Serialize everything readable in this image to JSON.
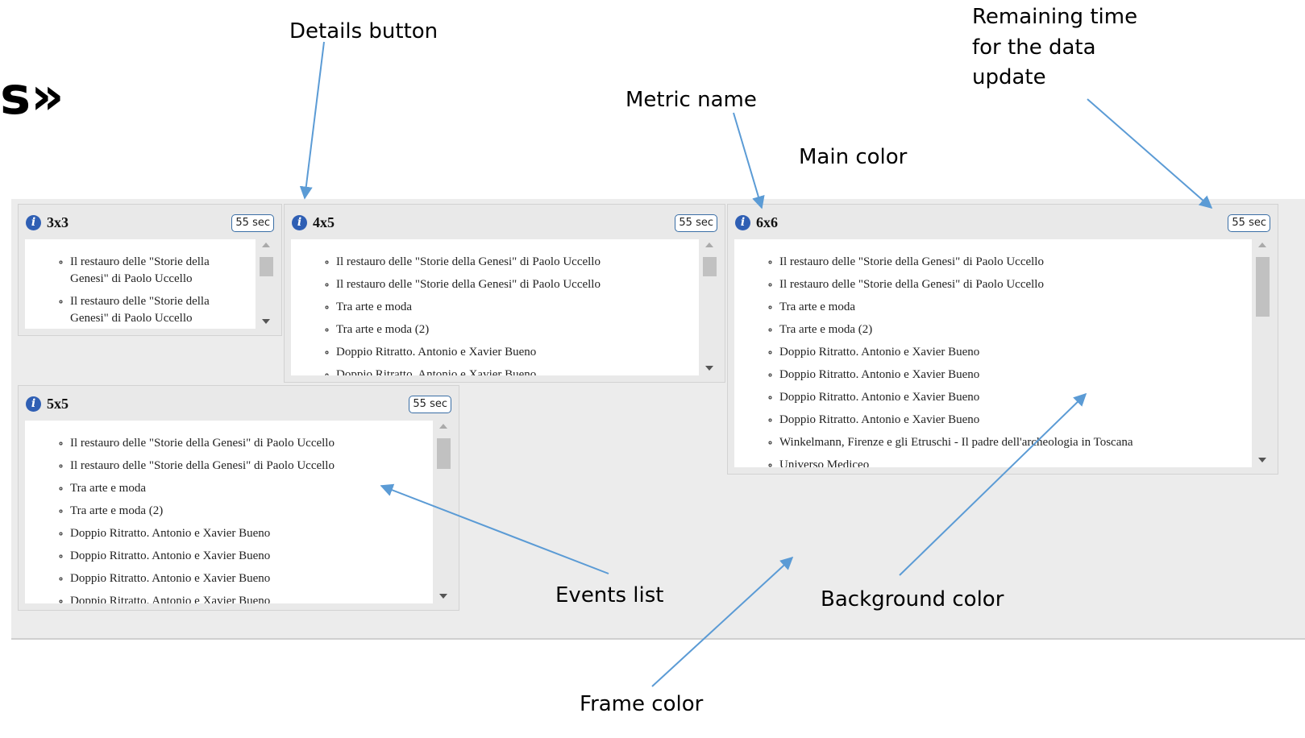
{
  "heading_fragment": "s»",
  "annotations": {
    "details_button": "Details button",
    "remaining_time": [
      "Remaining time",
      "for the data",
      "update"
    ],
    "metric_name": "Metric name",
    "main_color": "Main color",
    "events_list": "Events list",
    "background_color": "Background color",
    "frame_color": "Frame color"
  },
  "widgets": [
    {
      "metric": "3x3",
      "remaining": "55 sec",
      "events": [
        "Il restauro delle \"Storie della Genesi\" di Paolo Uccello",
        "Il restauro delle \"Storie della Genesi\" di Paolo Uccello"
      ]
    },
    {
      "metric": "4x5",
      "remaining": "55 sec",
      "events": [
        "Il restauro delle \"Storie della Genesi\" di Paolo Uccello",
        "Il restauro delle \"Storie della Genesi\" di Paolo Uccello",
        "Tra arte e moda",
        "Tra arte e moda (2)",
        "Doppio Ritratto. Antonio e Xavier Bueno",
        "Doppio Ritratto. Antonio e Xavier Bueno"
      ]
    },
    {
      "metric": "6x6",
      "remaining": "55 sec",
      "events": [
        "Il restauro delle \"Storie della Genesi\" di Paolo Uccello",
        "Il restauro delle \"Storie della Genesi\" di Paolo Uccello",
        "Tra arte e moda",
        "Tra arte e moda (2)",
        "Doppio Ritratto. Antonio e Xavier Bueno",
        "Doppio Ritratto. Antonio e Xavier Bueno",
        "Doppio Ritratto. Antonio e Xavier Bueno",
        "Doppio Ritratto. Antonio e Xavier Bueno",
        "Winkelmann, Firenze e gli Etruschi - Il padre dell'archeologia in Toscana",
        "Universo Mediceo"
      ]
    },
    {
      "metric": "5x5",
      "remaining": "55 sec",
      "events": [
        "Il restauro delle \"Storie della Genesi\" di Paolo Uccello",
        "Il restauro delle \"Storie della Genesi\" di Paolo Uccello",
        "Tra arte e moda",
        "Tra arte e moda (2)",
        "Doppio Ritratto. Antonio e Xavier Bueno",
        "Doppio Ritratto. Antonio e Xavier Bueno",
        "Doppio Ritratto. Antonio e Xavier Bueno",
        "Doppio Ritratto. Antonio e Xavier Bueno"
      ]
    }
  ],
  "colors": {
    "frame": "#ececec",
    "widget_background": "#e9e9e9",
    "events_background": "#ffffff",
    "info_icon": "#2f5fb4",
    "annotation_arrow": "#5b9bd5"
  }
}
